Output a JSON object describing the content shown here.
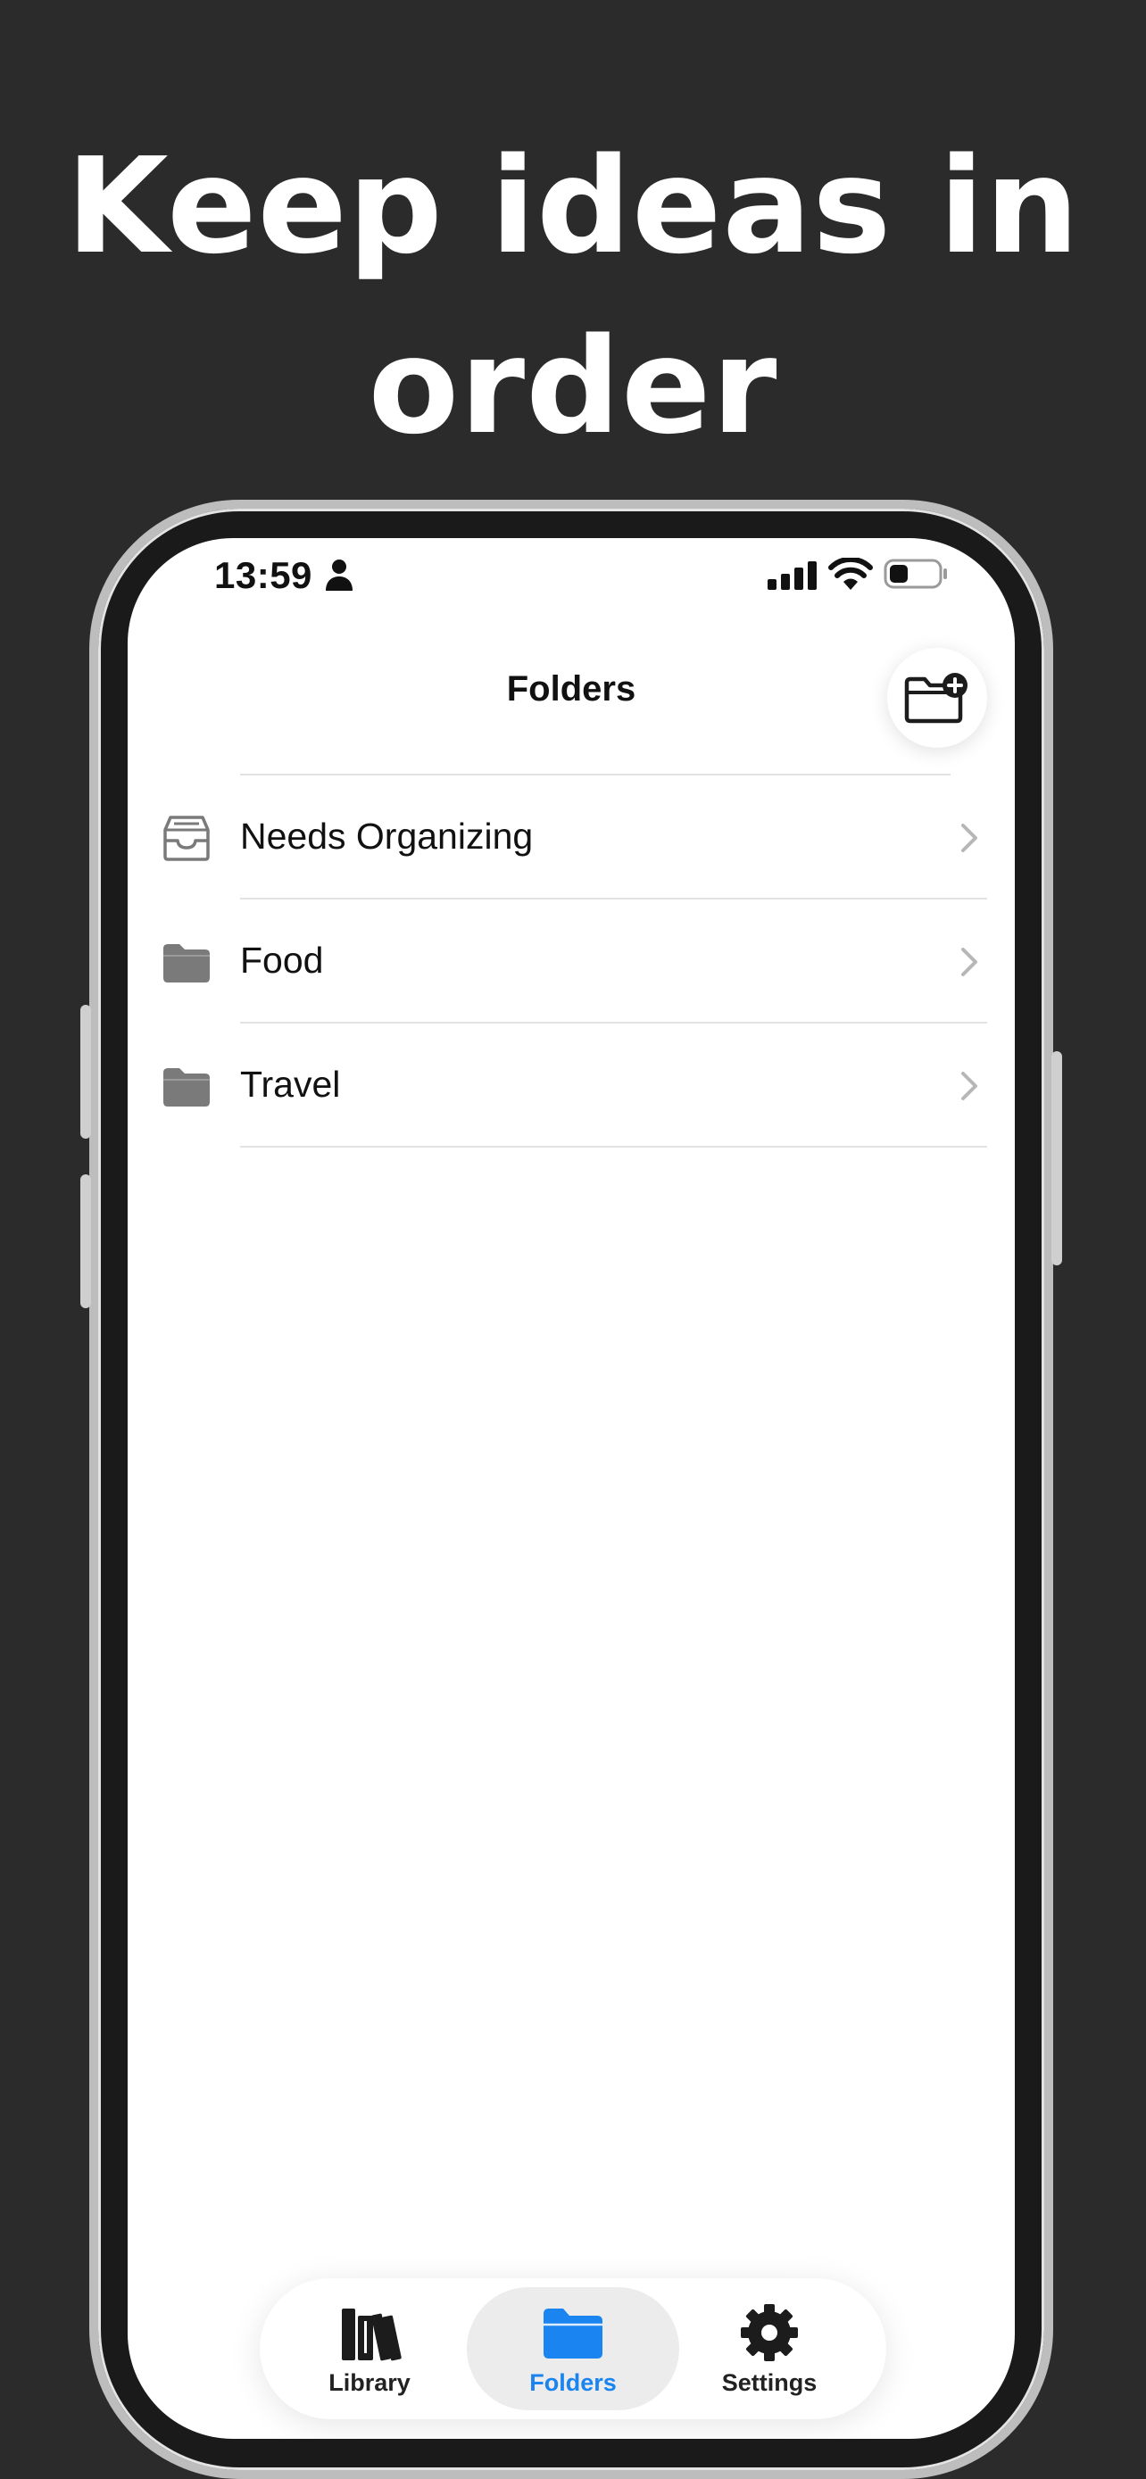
{
  "headline": {
    "line1": "Keep ideas in",
    "line2": "order"
  },
  "status_bar": {
    "time": "13:59",
    "icons": [
      "person-icon",
      "cellular-signal-icon",
      "wifi-icon",
      "battery-icon"
    ]
  },
  "header": {
    "title": "Folders",
    "new_folder_icon": "folder-plus-icon"
  },
  "folders": [
    {
      "label": "Needs Organizing",
      "icon": "inbox-tray-icon"
    },
    {
      "label": "Food",
      "icon": "folder-icon"
    },
    {
      "label": "Travel",
      "icon": "folder-icon"
    }
  ],
  "tab_bar": {
    "tabs": [
      {
        "label": "Library",
        "icon": "books-icon",
        "active": false
      },
      {
        "label": "Folders",
        "icon": "folder-icon",
        "active": true
      },
      {
        "label": "Settings",
        "icon": "gear-icon",
        "active": false
      }
    ]
  },
  "colors": {
    "background": "#2b2b2b",
    "accent": "#1a84f0",
    "folder_icon": "#7a7a7a",
    "divider": "#e2e2e2"
  }
}
